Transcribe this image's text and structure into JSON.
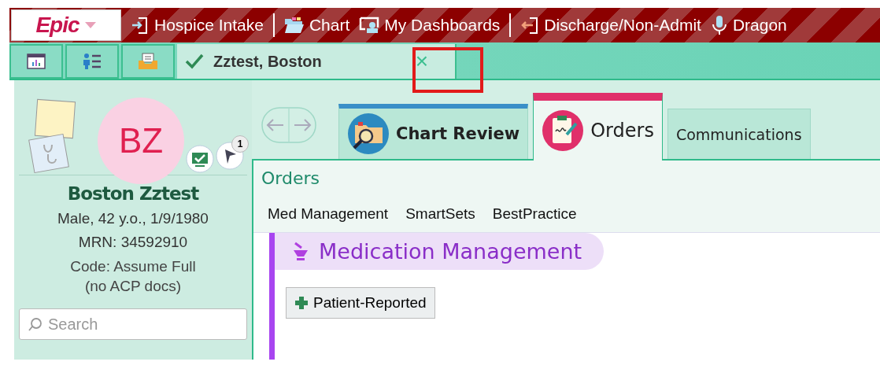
{
  "toolbar": {
    "logo": "Epic",
    "items": [
      {
        "kind": "button",
        "label": "Hospice Intake"
      },
      {
        "kind": "separator"
      },
      {
        "kind": "button",
        "label": "Chart"
      },
      {
        "kind": "button",
        "label": "My Dashboards"
      },
      {
        "kind": "separator"
      },
      {
        "kind": "button",
        "label": "Discharge/Non-Admit"
      },
      {
        "kind": "button",
        "label": "Dragon"
      }
    ]
  },
  "workspace_tabs": {
    "patient_tab": {
      "label": "Zztest, Boston",
      "checked": true,
      "close": "×"
    }
  },
  "patient": {
    "initials": "BZ",
    "name": "Boston Zztest",
    "details": [
      "Male, 42 y.o., 1/9/1980",
      "MRN: 34592910"
    ],
    "code_status": [
      "Code: Assume Full",
      "(no ACP docs)"
    ],
    "flag_count": "1",
    "search": {
      "placeholder": "Search"
    }
  },
  "activity_tabs": [
    {
      "label": "Chart Review",
      "selected": false,
      "color": "#3a8fc8"
    },
    {
      "label": "Orders",
      "selected": true,
      "color": "#e0306a"
    },
    {
      "label": "Communications",
      "selected": false,
      "color": "#9fd8c6"
    }
  ],
  "activity": {
    "title": "Orders",
    "links": [
      "Med Management",
      "SmartSets",
      "BestPractice"
    ],
    "section": {
      "title": "Medication Management",
      "buttons": [
        "Patient-Reported"
      ]
    }
  }
}
